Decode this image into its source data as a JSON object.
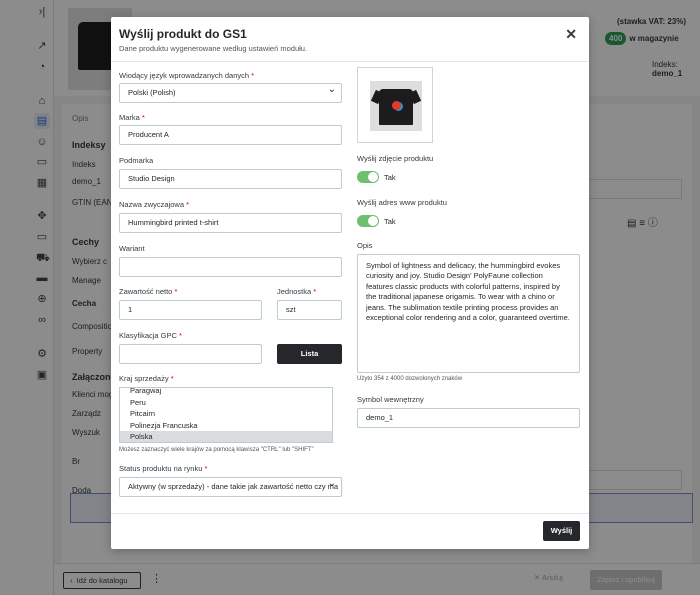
{
  "background": {
    "vat_text": "(stawka VAT: 23%)",
    "stock_count": "400",
    "stock_label": "w magazynie",
    "index_label": "Indeks:",
    "index_value": "demo_1",
    "tabs": [
      "Opis"
    ],
    "left_labels": [
      "Indeksy",
      "Indeks",
      "demo_1",
      "GTIN (EAN,",
      "Cechy",
      "Wybierz c",
      "Manage",
      "Cecha",
      "Composition",
      "Property",
      "Załączone",
      "Klienci mog",
      "Zarządz",
      "Wyszuk",
      "Br",
      "Doda"
    ],
    "footer": {
      "back_label": "Idź do katalogu",
      "cancel_label": "✕ Anuluj",
      "save_label": "Zapisz i opublikuj"
    }
  },
  "modal": {
    "title": "Wyślij produkt do GS1",
    "subtitle": "Dane produktu wygenerowane według ustawień modułu.",
    "fields": {
      "language_label": "Wiodący język wprowadzanych danych",
      "language_value": "Polski (Polish)",
      "brand_label": "Marka",
      "brand_value": "Producent A",
      "subbrand_label": "Podmarka",
      "subbrand_value": "Studio Design",
      "common_name_label": "Nazwa zwyczajowa",
      "common_name_value": "Hummingbird printed t-shirt",
      "variant_label": "Wariant",
      "variant_value": "",
      "net_content_label": "Zawartość netto",
      "net_content_value": "1",
      "unit_label": "Jednostka",
      "unit_value": "szt",
      "gpc_label": "Klasyfikacja GPC",
      "gpc_value": "",
      "gpc_button": "Lista",
      "country_label": "Kraj sprzedaży",
      "countries": [
        "Paragwaj",
        "Peru",
        "Pitcairn",
        "Polinezja Francuska",
        "Polska"
      ],
      "selected_country": "Polska",
      "country_help": "Możesz zaznaczyć wiele krajów za pomocą klawisza \"CTRL\" lub \"SHIFT\"",
      "status_label": "Status produktu na rynku",
      "status_value": "Aktywny (w sprzedaży) - dane takie jak zawartość netto czy ma"
    },
    "right": {
      "send_image_label": "Wyślij zdjęcie produktu",
      "send_image_toggle": "Tak",
      "send_url_label": "Wyślij adres www produktu",
      "send_url_toggle": "Tak",
      "description_label": "Opis",
      "description_text": "Symbol of lightness and delicacy, the hummingbird evokes curiosity and joy. Studio Design' PolyFaune collection features classic products with colorful patterns, inspired by the traditional japanese origamis. To wear with a chino or jeans. The sublimation textile printing process provides an exceptional color rendering and a color, guaranteed overtime.",
      "char_count": "Użyto 354 z 4000 dozwolonych znaków",
      "internal_symbol_label": "Symbol wewnętrzny",
      "internal_symbol_value": "demo_1"
    },
    "send_button": "Wyślij",
    "close_icon": "close-icon"
  },
  "colors": {
    "toggle_on": "#6cc070",
    "primary_button": "#25272b",
    "required": "#cc0000"
  }
}
